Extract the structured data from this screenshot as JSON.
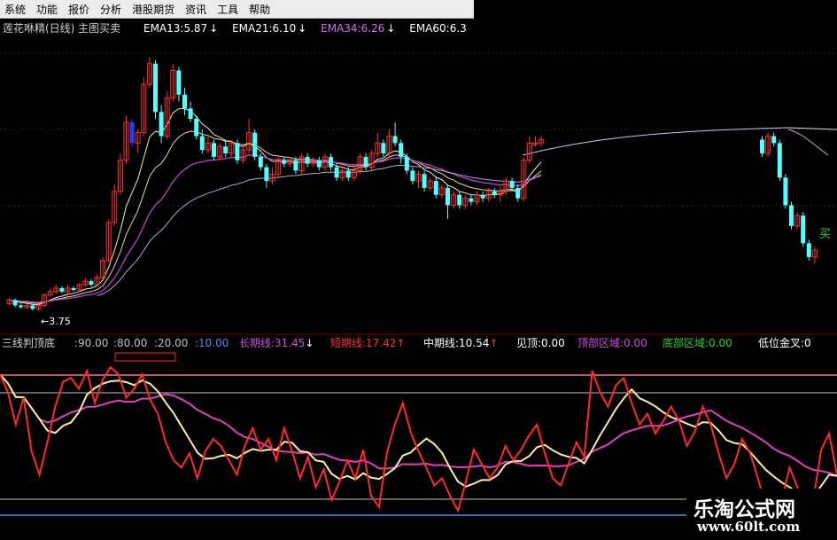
{
  "menu": [
    "系统",
    "功能",
    "报价",
    "分析",
    "港股期货",
    "资讯",
    "工具",
    "帮助"
  ],
  "main_panel": {
    "title": "莲花咻精(日线) 主图买卖",
    "ema": [
      {
        "label": "EMA13:5.87",
        "arrow": "↓",
        "color": "#ffffff"
      },
      {
        "label": "EMA21:6.10",
        "arrow": "↓",
        "color": "#ffffff"
      },
      {
        "label": "EMA34:6.26",
        "arrow": "↓",
        "color": "#d070f0"
      },
      {
        "label": "EMA60:6.3",
        "arrow": "",
        "color": "#ffffff"
      }
    ],
    "low_marker": "←3.75",
    "buy_label": "买"
  },
  "indicator_panel": {
    "name": "三线判顶底",
    "levels": [
      ":90.00",
      ":80.00",
      ":20.00",
      ":10.00"
    ],
    "level_colors": [
      "#c0c0c0",
      "#c0c0c0",
      "#c0c0c0",
      "#4f8df5"
    ],
    "values": [
      {
        "text": "长期线:31.45",
        "arrow": "↓",
        "color": "#d050e0"
      },
      {
        "text": "短期线:17.42",
        "arrow": "↑",
        "color": "#ff3030"
      },
      {
        "text": "中期线:10.54",
        "arrow": "↑",
        "color": "#ffffff"
      },
      {
        "text": "见顶:0.00",
        "arrow": "",
        "color": "#ffffff"
      },
      {
        "text": "顶部区域:0.00",
        "arrow": "",
        "color": "#d050e0"
      },
      {
        "text": "底部区域:0.00",
        "arrow": "",
        "color": "#30d030"
      },
      {
        "text": "低位金叉:0",
        "arrow": "",
        "color": "#ffffff"
      }
    ]
  },
  "watermark": {
    "name": "乐淘公式网",
    "url": "www.60lt.com"
  },
  "colors": {
    "up": "#ff3030",
    "down": "#54ffff",
    "blue_bar": "#2c3cff",
    "ema_white": "#f4f0c0",
    "ema_purple": "#b040c0",
    "ema_gray": "#a8a8d8",
    "long_line": "#e040c0",
    "short_line": "#ff2a2a",
    "mid_line": "#fff0a0"
  },
  "chart_data": {
    "type": "candlestick",
    "price_range": [
      3.5,
      11.2
    ],
    "low_price": 3.75,
    "candles": [
      [
        3.95,
        4.05,
        3.9,
        4.1
      ],
      [
        4.05,
        3.9,
        3.85,
        4.1
      ],
      [
        3.9,
        3.85,
        3.8,
        3.95
      ],
      [
        3.85,
        3.9,
        3.8,
        3.95
      ],
      [
        3.9,
        3.8,
        3.75,
        3.95
      ],
      [
        3.8,
        3.9,
        3.75,
        3.95
      ],
      [
        3.9,
        4.2,
        3.85,
        4.25
      ],
      [
        4.2,
        4.3,
        4.15,
        4.4
      ],
      [
        4.3,
        4.4,
        4.25,
        4.5
      ],
      [
        4.4,
        4.3,
        4.25,
        4.45
      ],
      [
        4.3,
        4.4,
        4.25,
        4.5
      ],
      [
        4.4,
        4.35,
        4.3,
        4.45
      ],
      [
        4.35,
        4.5,
        4.3,
        4.55
      ],
      [
        4.5,
        4.6,
        4.45,
        4.7
      ],
      [
        4.6,
        4.5,
        4.45,
        4.65
      ],
      [
        4.5,
        4.7,
        4.45,
        4.8
      ],
      [
        4.7,
        5.2,
        4.65,
        5.3
      ],
      [
        5.2,
        6.3,
        5.15,
        6.4
      ],
      [
        6.3,
        7.2,
        6.2,
        7.4
      ],
      [
        7.2,
        8.1,
        7.1,
        8.3
      ],
      [
        8.1,
        9.2,
        8.0,
        9.4
      ],
      [
        9.2,
        8.6,
        8.5,
        9.3
      ],
      [
        8.6,
        8.9,
        8.3,
        9.0
      ],
      [
        8.9,
        10.3,
        8.8,
        10.5
      ],
      [
        10.3,
        10.9,
        10.2,
        11.1
      ],
      [
        10.9,
        9.5,
        9.3,
        11.0
      ],
      [
        9.5,
        8.8,
        8.6,
        9.7
      ],
      [
        8.8,
        9.9,
        8.7,
        10.1
      ],
      [
        9.9,
        10.7,
        9.8,
        10.9
      ],
      [
        10.7,
        10.0,
        9.8,
        10.8
      ],
      [
        10.0,
        9.6,
        9.4,
        10.2
      ],
      [
        9.6,
        9.3,
        9.2,
        9.8
      ],
      [
        9.3,
        8.8,
        8.7,
        9.4
      ],
      [
        8.8,
        8.4,
        8.3,
        9.0
      ],
      [
        8.4,
        8.6,
        8.3,
        8.8
      ],
      [
        8.6,
        8.2,
        8.1,
        8.7
      ],
      [
        8.2,
        8.5,
        8.1,
        8.6
      ],
      [
        8.5,
        8.3,
        8.2,
        8.7
      ],
      [
        8.3,
        8.6,
        8.2,
        8.7
      ],
      [
        8.6,
        8.1,
        8.0,
        8.7
      ],
      [
        8.1,
        8.4,
        8.0,
        8.5
      ],
      [
        8.4,
        8.9,
        8.3,
        9.3
      ],
      [
        8.9,
        8.2,
        8.1,
        9.0
      ],
      [
        8.2,
        7.9,
        7.8,
        8.3
      ],
      [
        7.9,
        7.5,
        7.3,
        8.0
      ],
      [
        7.5,
        7.7,
        7.4,
        7.9
      ],
      [
        7.7,
        8.1,
        7.6,
        8.2
      ],
      [
        8.1,
        8.0,
        7.9,
        8.2
      ],
      [
        8.0,
        8.1,
        7.9,
        8.2
      ],
      [
        8.1,
        7.8,
        7.7,
        8.2
      ],
      [
        7.8,
        8.2,
        7.7,
        8.3
      ],
      [
        8.2,
        8.0,
        7.9,
        8.3
      ],
      [
        8.0,
        8.1,
        7.9,
        8.2
      ],
      [
        8.1,
        7.9,
        7.8,
        8.2
      ],
      [
        7.9,
        8.2,
        7.8,
        8.3
      ],
      [
        8.2,
        7.9,
        7.8,
        8.3
      ],
      [
        7.9,
        7.6,
        7.5,
        8.0
      ],
      [
        7.6,
        7.8,
        7.5,
        7.9
      ],
      [
        7.8,
        7.6,
        7.5,
        7.9
      ],
      [
        7.6,
        7.8,
        7.5,
        8.0
      ],
      [
        7.8,
        8.2,
        7.7,
        8.3
      ],
      [
        8.2,
        7.9,
        7.8,
        8.3
      ],
      [
        7.9,
        8.3,
        7.8,
        8.4
      ],
      [
        8.3,
        8.6,
        8.2,
        8.9
      ],
      [
        8.6,
        8.3,
        8.2,
        8.7
      ],
      [
        8.3,
        8.8,
        8.2,
        9.0
      ],
      [
        8.8,
        8.6,
        8.5,
        9.2
      ],
      [
        8.6,
        8.2,
        8.0,
        8.7
      ],
      [
        8.2,
        7.8,
        7.7,
        8.3
      ],
      [
        7.8,
        7.5,
        7.4,
        7.9
      ],
      [
        7.5,
        7.7,
        7.3,
        7.8
      ],
      [
        7.7,
        7.3,
        7.2,
        7.8
      ],
      [
        7.3,
        7.5,
        7.2,
        7.6
      ],
      [
        7.5,
        7.1,
        7.0,
        7.6
      ],
      [
        7.1,
        7.3,
        7.0,
        7.4
      ],
      [
        7.3,
        6.8,
        6.4,
        7.4
      ],
      [
        6.8,
        7.1,
        6.7,
        7.2
      ],
      [
        7.1,
        6.8,
        6.7,
        7.2
      ],
      [
        6.8,
        7.0,
        6.7,
        7.1
      ],
      [
        7.0,
        6.9,
        6.8,
        7.1
      ],
      [
        6.9,
        7.1,
        6.8,
        7.2
      ],
      [
        7.1,
        7.0,
        6.9,
        7.2
      ],
      [
        7.0,
        7.2,
        6.9,
        7.3
      ],
      [
        7.2,
        7.1,
        7.0,
        7.3
      ],
      [
        7.1,
        7.2,
        6.9,
        7.4
      ],
      [
        7.2,
        7.5,
        7.1,
        7.6
      ],
      [
        7.5,
        7.3,
        7.2,
        7.6
      ],
      [
        7.3,
        7.0,
        6.9,
        7.4
      ],
      [
        7.0,
        8.1,
        6.9,
        8.2
      ],
      [
        8.1,
        8.6,
        8.0,
        8.8
      ],
      [
        8.6,
        8.6,
        8.5,
        8.8
      ],
      [
        8.6,
        8.7,
        8.5,
        8.8
      ]
    ],
    "tail_candles": [
      [
        8.7,
        8.3,
        8.2,
        8.8
      ],
      [
        8.3,
        8.8,
        8.2,
        8.9
      ],
      [
        8.8,
        8.6,
        8.5,
        8.9
      ],
      [
        8.6,
        7.6,
        7.5,
        8.7
      ],
      [
        7.6,
        6.8,
        6.7,
        7.7
      ],
      [
        6.8,
        6.2,
        6.1,
        6.9
      ],
      [
        6.2,
        6.5,
        6.1,
        6.6
      ],
      [
        6.5,
        5.7,
        5.6,
        6.6
      ],
      [
        5.7,
        5.3,
        5.2,
        5.8
      ],
      [
        5.3,
        5.5,
        5.1,
        5.6
      ]
    ],
    "indicator": {
      "range": [
        0,
        100
      ],
      "reference_levels": [
        90,
        80,
        20,
        10
      ],
      "short_line": [
        88,
        78,
        60,
        75,
        45,
        32,
        50,
        70,
        84,
        86,
        80,
        90,
        72,
        85,
        92,
        88,
        75,
        80,
        88,
        74,
        66,
        50,
        40,
        36,
        44,
        30,
        45,
        52,
        48,
        40,
        32,
        48,
        58,
        46,
        52,
        40,
        58,
        45,
        30,
        42,
        25,
        35,
        18,
        28,
        40,
        30,
        46,
        20,
        14,
        44,
        60,
        72,
        56,
        45,
        36,
        26,
        30,
        20,
        12,
        28,
        46,
        38,
        30,
        36,
        48,
        40,
        46,
        54,
        60,
        44,
        30,
        26,
        38,
        50,
        42,
        90,
        78,
        70,
        82,
        86,
        72,
        60,
        66,
        55,
        62,
        70,
        62,
        48,
        56,
        70,
        60,
        44,
        30,
        38,
        52,
        44,
        30,
        14,
        8,
        18,
        36,
        25,
        12,
        18,
        46,
        55,
        32
      ]
    }
  }
}
